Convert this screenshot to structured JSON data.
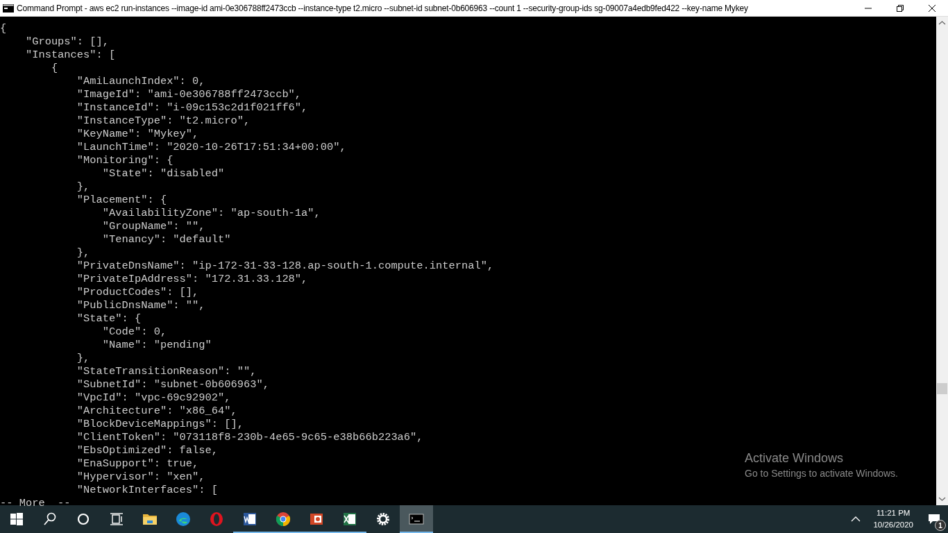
{
  "window": {
    "title": "Command Prompt - aws  ec2 run-instances --image-id ami-0e306788ff2473ccb --instance-type t2.micro --subnet-id subnet-0b606963 --count 1 --security-group-ids sg-09007a4edb9fed422 --key-name Mykey"
  },
  "console": {
    "lines": [
      "{",
      "    \"Groups\": [],",
      "    \"Instances\": [",
      "        {",
      "            \"AmiLaunchIndex\": 0,",
      "            \"ImageId\": \"ami-0e306788ff2473ccb\",",
      "            \"InstanceId\": \"i-09c153c2d1f021ff6\",",
      "            \"InstanceType\": \"t2.micro\",",
      "            \"KeyName\": \"Mykey\",",
      "            \"LaunchTime\": \"2020-10-26T17:51:34+00:00\",",
      "            \"Monitoring\": {",
      "                \"State\": \"disabled\"",
      "            },",
      "            \"Placement\": {",
      "                \"AvailabilityZone\": \"ap-south-1a\",",
      "                \"GroupName\": \"\",",
      "                \"Tenancy\": \"default\"",
      "            },",
      "            \"PrivateDnsName\": \"ip-172-31-33-128.ap-south-1.compute.internal\",",
      "            \"PrivateIpAddress\": \"172.31.33.128\",",
      "            \"ProductCodes\": [],",
      "            \"PublicDnsName\": \"\",",
      "            \"State\": {",
      "                \"Code\": 0,",
      "                \"Name\": \"pending\"",
      "            },",
      "            \"StateTransitionReason\": \"\",",
      "            \"SubnetId\": \"subnet-0b606963\",",
      "            \"VpcId\": \"vpc-69c92902\",",
      "            \"Architecture\": \"x86_64\",",
      "            \"BlockDeviceMappings\": [],",
      "            \"ClientToken\": \"073118f8-230b-4e65-9c65-e38b66b223a6\",",
      "            \"EbsOptimized\": false,",
      "            \"EnaSupport\": true,",
      "            \"Hypervisor\": \"xen\",",
      "            \"NetworkInterfaces\": [",
      "-- More  --"
    ]
  },
  "activation_notice": {
    "title": "Activate Windows",
    "message": "Go to Settings to activate Windows."
  },
  "taskbar": {
    "items": [
      {
        "kind": "start",
        "running": false,
        "selected": false
      },
      {
        "kind": "search",
        "running": false,
        "selected": false
      },
      {
        "kind": "cortana",
        "running": false,
        "selected": false
      },
      {
        "kind": "taskview",
        "running": false,
        "selected": false
      },
      {
        "kind": "folder",
        "running": false,
        "selected": false
      },
      {
        "kind": "edge",
        "running": false,
        "selected": false
      },
      {
        "kind": "opera",
        "running": false,
        "selected": false
      },
      {
        "kind": "word",
        "running": true,
        "selected": false
      },
      {
        "kind": "chrome",
        "running": true,
        "selected": false
      },
      {
        "kind": "powerpoint",
        "running": true,
        "selected": false
      },
      {
        "kind": "excel",
        "running": true,
        "selected": false
      },
      {
        "kind": "settings",
        "running": false,
        "selected": false
      },
      {
        "kind": "terminal",
        "running": true,
        "selected": true
      }
    ],
    "time": "11:21 PM",
    "date": "10/26/2020",
    "notification_count": "1"
  }
}
